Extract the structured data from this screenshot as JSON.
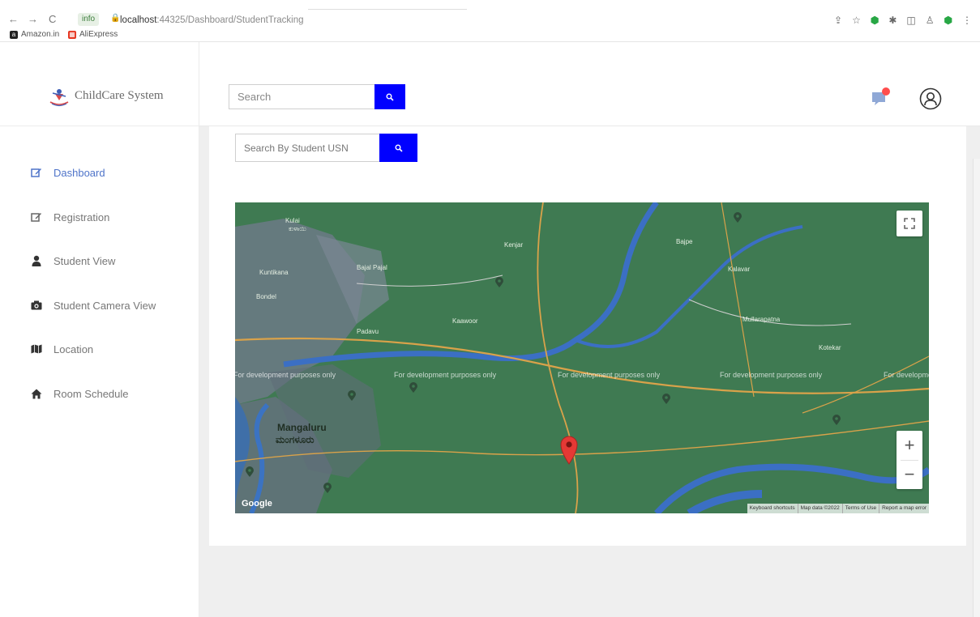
{
  "browser": {
    "nav": {
      "back": "←",
      "forward": "→",
      "reload": "C"
    },
    "address": {
      "site_chip": "info",
      "lock": "🔒",
      "host": "localhost",
      "path": ":44325/Dashboard/StudentTracking"
    },
    "bookmarks": [
      {
        "label": "Amazon.in",
        "icon_color": "#222222"
      },
      {
        "label": "AliExpress",
        "icon_color": "#e6341f"
      }
    ]
  },
  "brand": {
    "name": "ChildCare System"
  },
  "topbar": {
    "search_placeholder": "Search",
    "notification_color": "#ff4d4d"
  },
  "sidebar": {
    "items": [
      {
        "label": "Dashboard",
        "icon": "edit-icon",
        "active": true
      },
      {
        "label": "Registration",
        "icon": "edit-icon",
        "active": false
      },
      {
        "label": "Student View",
        "icon": "user-icon",
        "active": false
      },
      {
        "label": "Student Camera View",
        "icon": "camera-icon",
        "active": false
      },
      {
        "label": "Location",
        "icon": "map-icon",
        "active": false
      },
      {
        "label": "Room Schedule",
        "icon": "home-icon",
        "active": false
      }
    ]
  },
  "tracking": {
    "usn_placeholder": "Search By Student USN",
    "accent": "#0000ff"
  },
  "map": {
    "city": "Mangaluru",
    "city_local": "ಮಂಗಳೂರು",
    "labels": [
      "Kulai",
      "ಕುಳಾಯಿ",
      "Kuntikana",
      "Bajal Pajal",
      "Bondel",
      "Padavu",
      "Kaawoor",
      "Kenjar",
      "Bajpe",
      "Kalavar",
      "Mullarapatna",
      "Kotekar"
    ],
    "watermark": "For development purposes only",
    "attribution": [
      "Keyboard shortcuts",
      "Map data ©2022",
      "Terms of Use",
      "Report a map error"
    ],
    "google": "Google",
    "zoom_in": "+",
    "zoom_out": "−",
    "marker_color": "#e53935"
  }
}
